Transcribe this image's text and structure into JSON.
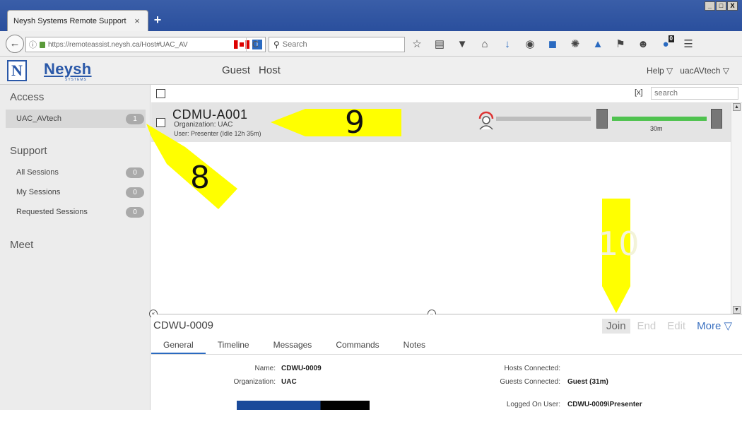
{
  "browser": {
    "tab_title": "Neysh Systems Remote Support",
    "tab_close": "×",
    "new_tab": "+",
    "window_controls": [
      "_",
      "□",
      "X"
    ],
    "back_icon": "back-arrow-icon",
    "url": "https://remoteassist.neysh.ca/Host#UAC_AV",
    "reload_symbol": "C",
    "search_placeholder": "Search",
    "toolbar_icons": [
      "star-icon",
      "clipboard-icon",
      "pocket-icon",
      "home-icon",
      "download-icon",
      "translate-icon",
      "extension-icon",
      "bug-icon",
      "screenshot-icon",
      "flag-icon",
      "chat-icon",
      "notification-icon",
      "menu-icon"
    ],
    "notification_count": "0"
  },
  "app": {
    "logo_letter": "N",
    "logo_text": "Neysh",
    "logo_sub": "SYSTEMS",
    "nav": [
      "Guest",
      "Host"
    ],
    "help_label": "Help ▽",
    "user_label": "uacAVtech ▽"
  },
  "sidebar": {
    "access_title": "Access",
    "access_items": [
      {
        "label": "UAC_AVtech",
        "count": "1"
      }
    ],
    "support_title": "Support",
    "support_items": [
      {
        "label": "All Sessions",
        "count": "0"
      },
      {
        "label": "My Sessions",
        "count": "0"
      },
      {
        "label": "Requested Sessions",
        "count": "0"
      }
    ],
    "meet_title": "Meet"
  },
  "list": {
    "clear_label": "[x]",
    "search_placeholder": "search",
    "session": {
      "name": "CDMU-A001",
      "organization": "Organization: UAC",
      "user": "User: Presenter (Idle 12h 35m)",
      "connection_time": "30m"
    }
  },
  "annotations": {
    "arrow_8": "8",
    "arrow_9": "9",
    "arrow_10": "10",
    "color": "#ffff00"
  },
  "detail": {
    "title": "CDWU-0009",
    "actions": {
      "join": "Join",
      "end": "End",
      "edit": "Edit",
      "more": "More ▽"
    },
    "tabs": [
      "General",
      "Timeline",
      "Messages",
      "Commands",
      "Notes"
    ],
    "fields": {
      "name_label": "Name:",
      "name_value": "CDWU-0009",
      "org_label": "Organization:",
      "org_value": "UAC",
      "hosts_label": "Hosts Connected:",
      "hosts_value": "",
      "guests_label": "Guests Connected:",
      "guests_value": "Guest (31m)",
      "logged_label": "Logged On User:",
      "logged_value": "CDWU-0009\\Presenter"
    }
  },
  "colors": {
    "brand": "#2a58a8",
    "accent": "#2a6ac0",
    "green": "#4fc24f"
  }
}
